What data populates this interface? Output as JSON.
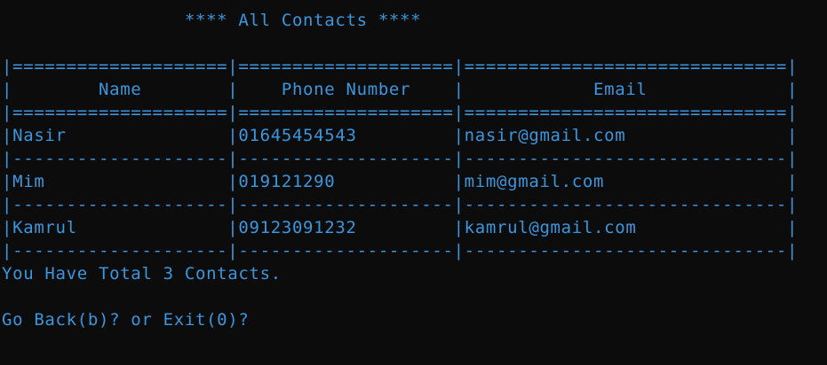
{
  "terminal": {
    "title_line": "                 **** All Contacts ****",
    "table_lines": [
      "|====================|====================|==============================|",
      "|        Name        |    Phone Number    |            Email             |",
      "|====================|====================|==============================|",
      "|Nasir               |01645454543         |nasir@gmail.com               |",
      "|--------------------|--------------------|------------------------------|",
      "|Mim                 |019121290           |mim@gmail.com                 |",
      "|--------------------|--------------------|------------------------------|",
      "|Kamrul              |09123091232         |kamrul@gmail.com              |",
      "|--------------------|--------------------|------------------------------|"
    ],
    "total_line": "You Have Total 3 Contacts.",
    "prompt_line": "Go Back(b)? or Exit(0)?"
  }
}
